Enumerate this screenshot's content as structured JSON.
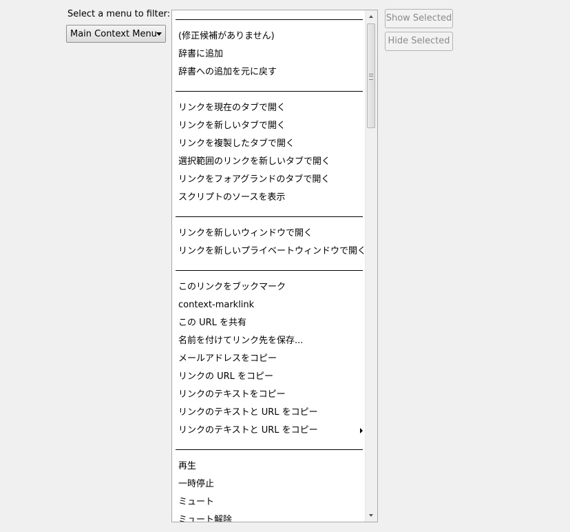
{
  "filter": {
    "label": "Select a menu to filter:",
    "selected": "Main Context Menu"
  },
  "buttons": {
    "show": "Show Selected",
    "hide": "Hide Selected"
  },
  "menu_items": [
    "(修正候補がありません)",
    "辞書に追加",
    "辞書への追加を元に戻す",
    "リンクを現在のタブで開く",
    "リンクを新しいタブで開く",
    "リンクを複製したタブで開く",
    "選択範囲のリンクを新しいタブで開く",
    "リンクをフォアグランドのタブで開く",
    "スクリプトのソースを表示",
    "リンクを新しいウィンドウで開く",
    "リンクを新しいプライベートウィンドウで開く",
    "このリンクをブックマーク",
    "context-marklink",
    "この URL を共有",
    "名前を付けてリンク先を保存...",
    "メールアドレスをコピー",
    "リンクの URL をコピー",
    "リンクのテキストをコピー",
    "リンクのテキストと URL をコピー",
    "リンクのテキストと URL をコピー",
    "再生",
    "一時停止",
    "ミュート",
    "ミュート解除"
  ]
}
